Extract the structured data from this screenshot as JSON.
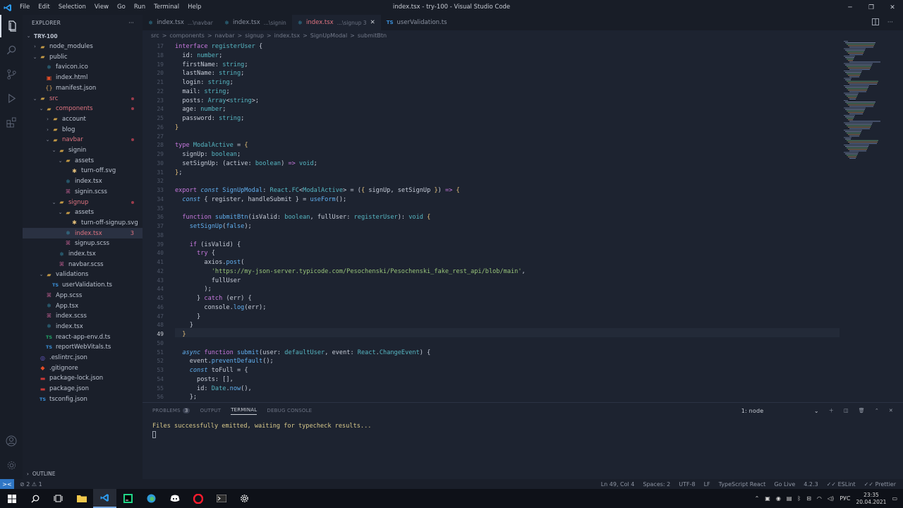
{
  "window": {
    "title": "index.tsx - try-100 - Visual Studio Code",
    "menu": [
      "File",
      "Edit",
      "Selection",
      "View",
      "Go",
      "Run",
      "Terminal",
      "Help"
    ]
  },
  "sidebar": {
    "header": "EXPLORER",
    "more": "···",
    "outline": "OUTLINE",
    "tree": [
      {
        "label": "TRY-100",
        "depth": 0,
        "kind": "root",
        "open": true,
        "color": "norm"
      },
      {
        "label": "node_modules",
        "depth": 1,
        "kind": "folder",
        "open": false,
        "color": "norm"
      },
      {
        "label": "public",
        "depth": 1,
        "kind": "folder",
        "open": true,
        "color": "norm"
      },
      {
        "label": "favicon.ico",
        "depth": 2,
        "kind": "file",
        "icon": "react",
        "color": "norm"
      },
      {
        "label": "index.html",
        "depth": 2,
        "kind": "file",
        "icon": "html",
        "color": "norm"
      },
      {
        "label": "manifest.json",
        "depth": 2,
        "kind": "file",
        "icon": "json",
        "color": "norm"
      },
      {
        "label": "src",
        "depth": 1,
        "kind": "folder",
        "open": true,
        "color": "err",
        "dot": true
      },
      {
        "label": "components",
        "depth": 2,
        "kind": "folder",
        "open": true,
        "color": "err",
        "dot": true
      },
      {
        "label": "account",
        "depth": 3,
        "kind": "folder",
        "open": false,
        "color": "norm"
      },
      {
        "label": "blog",
        "depth": 3,
        "kind": "folder",
        "open": false,
        "color": "norm"
      },
      {
        "label": "navbar",
        "depth": 3,
        "kind": "folder",
        "open": true,
        "color": "err",
        "dot": true
      },
      {
        "label": "signin",
        "depth": 4,
        "kind": "folder",
        "open": true,
        "color": "norm"
      },
      {
        "label": "assets",
        "depth": 5,
        "kind": "folder",
        "open": true,
        "color": "norm"
      },
      {
        "label": "turn-off.svg",
        "depth": 6,
        "kind": "file",
        "icon": "svg",
        "color": "norm"
      },
      {
        "label": "index.tsx",
        "depth": 5,
        "kind": "file",
        "icon": "react",
        "color": "norm"
      },
      {
        "label": "signin.scss",
        "depth": 5,
        "kind": "file",
        "icon": "scss",
        "color": "norm"
      },
      {
        "label": "signup",
        "depth": 4,
        "kind": "folder",
        "open": true,
        "color": "err",
        "dot": true
      },
      {
        "label": "assets",
        "depth": 5,
        "kind": "folder",
        "open": true,
        "color": "norm"
      },
      {
        "label": "turn-off-signup.svg",
        "depth": 6,
        "kind": "file",
        "icon": "svg",
        "color": "norm"
      },
      {
        "label": "index.tsx",
        "depth": 5,
        "kind": "file",
        "icon": "react",
        "color": "err",
        "badge": "3",
        "selected": true
      },
      {
        "label": "signup.scss",
        "depth": 5,
        "kind": "file",
        "icon": "scss",
        "color": "norm"
      },
      {
        "label": "index.tsx",
        "depth": 4,
        "kind": "file",
        "icon": "react",
        "color": "norm"
      },
      {
        "label": "navbar.scss",
        "depth": 4,
        "kind": "file",
        "icon": "scss",
        "color": "norm"
      },
      {
        "label": "validations",
        "depth": 2,
        "kind": "folder",
        "open": true,
        "color": "norm"
      },
      {
        "label": "userValidation.ts",
        "depth": 3,
        "kind": "file",
        "icon": "ts",
        "color": "norm"
      },
      {
        "label": "App.scss",
        "depth": 2,
        "kind": "file",
        "icon": "scss",
        "color": "norm"
      },
      {
        "label": "App.tsx",
        "depth": 2,
        "kind": "file",
        "icon": "react",
        "color": "norm"
      },
      {
        "label": "index.scss",
        "depth": 2,
        "kind": "file",
        "icon": "scss",
        "color": "norm"
      },
      {
        "label": "index.tsx",
        "depth": 2,
        "kind": "file",
        "icon": "react",
        "color": "norm"
      },
      {
        "label": "react-app-env.d.ts",
        "depth": 2,
        "kind": "file",
        "icon": "ts2",
        "color": "norm"
      },
      {
        "label": "reportWebVitals.ts",
        "depth": 2,
        "kind": "file",
        "icon": "ts",
        "color": "norm"
      },
      {
        "label": ".eslintrc.json",
        "depth": 1,
        "kind": "file",
        "icon": "eslint",
        "color": "norm"
      },
      {
        "label": ".gitignore",
        "depth": 1,
        "kind": "file",
        "icon": "git",
        "color": "norm"
      },
      {
        "label": "package-lock.json",
        "depth": 1,
        "kind": "file",
        "icon": "npm",
        "color": "norm"
      },
      {
        "label": "package.json",
        "depth": 1,
        "kind": "file",
        "icon": "npm",
        "color": "norm"
      },
      {
        "label": "tsconfig.json",
        "depth": 1,
        "kind": "file",
        "icon": "ts",
        "color": "norm"
      }
    ]
  },
  "tabs": [
    {
      "name": "index.tsx",
      "sub": "...\\navbar",
      "icon": "react",
      "active": false
    },
    {
      "name": "index.tsx",
      "sub": "...\\signin",
      "icon": "react",
      "active": false
    },
    {
      "name": "index.tsx",
      "sub": "...\\signup 3",
      "icon": "react",
      "active": true,
      "close": "✕"
    },
    {
      "name": "userValidation.ts",
      "sub": "",
      "icon": "ts",
      "active": false
    }
  ],
  "breadcrumb": [
    "src",
    ">",
    "components",
    ">",
    "navbar",
    ">",
    "signup",
    ">",
    "index.tsx",
    ">",
    "SignUpModal",
    ">",
    "submitBtn"
  ],
  "code": {
    "lines": [
      {
        "n": "17",
        "t": [
          [
            "kw",
            "interface "
          ],
          [
            "ty",
            "registerUser"
          ],
          [
            "pu",
            " {"
          ]
        ]
      },
      {
        "n": "18",
        "t": [
          [
            "pu",
            "  id"
          ],
          [
            "pu",
            ": "
          ],
          [
            "ty",
            "number"
          ],
          [
            "pu",
            ";"
          ]
        ]
      },
      {
        "n": "19",
        "t": [
          [
            "pu",
            "  firstName"
          ],
          [
            "pu",
            ": "
          ],
          [
            "ty",
            "string"
          ],
          [
            "pu",
            ";"
          ]
        ]
      },
      {
        "n": "20",
        "t": [
          [
            "pu",
            "  lastName"
          ],
          [
            "pu",
            ": "
          ],
          [
            "ty",
            "string"
          ],
          [
            "pu",
            ";"
          ]
        ]
      },
      {
        "n": "21",
        "t": [
          [
            "pu",
            "  login"
          ],
          [
            "pu",
            ": "
          ],
          [
            "ty",
            "string"
          ],
          [
            "pu",
            ";"
          ]
        ]
      },
      {
        "n": "22",
        "t": [
          [
            "pu",
            "  mail"
          ],
          [
            "pu",
            ": "
          ],
          [
            "ty",
            "string"
          ],
          [
            "pu",
            ";"
          ]
        ]
      },
      {
        "n": "23",
        "t": [
          [
            "pu",
            "  posts"
          ],
          [
            "pu",
            ": "
          ],
          [
            "ty",
            "Array"
          ],
          [
            "pu",
            "<"
          ],
          [
            "ty",
            "string"
          ],
          [
            "pu",
            ">;"
          ]
        ]
      },
      {
        "n": "24",
        "t": [
          [
            "pu",
            "  age"
          ],
          [
            "pu",
            ": "
          ],
          [
            "ty",
            "number"
          ],
          [
            "pu",
            ";"
          ]
        ]
      },
      {
        "n": "25",
        "t": [
          [
            "pu",
            "  password"
          ],
          [
            "pu",
            ": "
          ],
          [
            "ty",
            "string"
          ],
          [
            "pu",
            ";"
          ]
        ]
      },
      {
        "n": "26",
        "t": [
          [
            "pa",
            "}"
          ]
        ]
      },
      {
        "n": "27",
        "t": []
      },
      {
        "n": "28",
        "t": [
          [
            "kw",
            "type "
          ],
          [
            "ty",
            "ModalActive"
          ],
          [
            "pu",
            " = "
          ],
          [
            "pa",
            "{"
          ]
        ]
      },
      {
        "n": "29",
        "t": [
          [
            "pu",
            "  signUp"
          ],
          [
            "pu",
            ": "
          ],
          [
            "ty",
            "boolean"
          ],
          [
            "pu",
            ";"
          ]
        ]
      },
      {
        "n": "30",
        "t": [
          [
            "pu",
            "  setSignUp"
          ],
          [
            "pu",
            ": ("
          ],
          [
            "pu",
            "active"
          ],
          [
            "pu",
            ": "
          ],
          [
            "ty",
            "boolean"
          ],
          [
            "pu",
            ") "
          ],
          [
            "kw",
            "=> "
          ],
          [
            "ty",
            "void"
          ],
          [
            "pu",
            ";"
          ]
        ]
      },
      {
        "n": "31",
        "t": [
          [
            "pa",
            "}"
          ],
          [
            "pu",
            ";"
          ]
        ]
      },
      {
        "n": "32",
        "t": []
      },
      {
        "n": "33",
        "t": [
          [
            "kw",
            "export "
          ],
          [
            "kb it",
            "const "
          ],
          [
            "fn",
            "SignUpModal"
          ],
          [
            "pu",
            ": "
          ],
          [
            "ty",
            "React"
          ],
          [
            "pu",
            "."
          ],
          [
            "ty",
            "FC"
          ],
          [
            "pu",
            "<"
          ],
          [
            "ty",
            "ModalActive"
          ],
          [
            "pu",
            "> = ("
          ],
          [
            "pa",
            "{ "
          ],
          [
            "pu",
            "signUp"
          ],
          [
            "pu",
            ", "
          ],
          [
            "pu",
            "setSignUp "
          ],
          [
            "pa",
            "}"
          ],
          [
            "pu",
            ") "
          ],
          [
            "kw",
            "=> "
          ],
          [
            "pa",
            "{"
          ]
        ]
      },
      {
        "n": "34",
        "t": [
          [
            "kb it",
            "  const "
          ],
          [
            "pu",
            "{ register, handleSubmit } = "
          ],
          [
            "fn",
            "useForm"
          ],
          [
            "pu",
            "();"
          ]
        ]
      },
      {
        "n": "35",
        "t": []
      },
      {
        "n": "36",
        "t": [
          [
            "kw",
            "  function "
          ],
          [
            "fn",
            "submitBtn"
          ],
          [
            "pu",
            "("
          ],
          [
            "pu",
            "isValid"
          ],
          [
            "pu",
            ": "
          ],
          [
            "ty",
            "boolean"
          ],
          [
            "pu",
            ", "
          ],
          [
            "pu",
            "fullUser"
          ],
          [
            "pu",
            ": "
          ],
          [
            "ty",
            "registerUser"
          ],
          [
            "pu",
            "): "
          ],
          [
            "ty",
            "void "
          ],
          [
            "pa",
            "{"
          ]
        ]
      },
      {
        "n": "37",
        "t": [
          [
            "fn",
            "    setSignUp"
          ],
          [
            "pu",
            "("
          ],
          [
            "kb",
            "false"
          ],
          [
            "pu",
            ");"
          ]
        ]
      },
      {
        "n": "38",
        "t": []
      },
      {
        "n": "39",
        "t": [
          [
            "kw",
            "    if "
          ],
          [
            "pu",
            "(isValid) {"
          ]
        ]
      },
      {
        "n": "40",
        "t": [
          [
            "kw",
            "      try "
          ],
          [
            "pu",
            "{"
          ]
        ]
      },
      {
        "n": "41",
        "t": [
          [
            "pu",
            "        axios."
          ],
          [
            "fn",
            "post"
          ],
          [
            "pu",
            "("
          ]
        ]
      },
      {
        "n": "42",
        "t": [
          [
            "st",
            "          'https://my-json-server.typicode.com/Pesochenski/Pesochenski_fake_rest_api/blob/main'"
          ],
          [
            "pu",
            ","
          ]
        ]
      },
      {
        "n": "43",
        "t": [
          [
            "pu",
            "          fullUser"
          ]
        ]
      },
      {
        "n": "44",
        "t": [
          [
            "pu",
            "        );"
          ]
        ]
      },
      {
        "n": "45",
        "t": [
          [
            "pu",
            "      } "
          ],
          [
            "kw",
            "catch "
          ],
          [
            "pu",
            "(err) {"
          ]
        ]
      },
      {
        "n": "46",
        "t": [
          [
            "pu",
            "        console."
          ],
          [
            "fn",
            "log"
          ],
          [
            "pu",
            "(err);"
          ]
        ]
      },
      {
        "n": "47",
        "t": [
          [
            "pu",
            "      }"
          ]
        ]
      },
      {
        "n": "48",
        "t": [
          [
            "pu",
            "    }"
          ]
        ]
      },
      {
        "n": "49",
        "t": [
          [
            "pa",
            "  }"
          ]
        ],
        "current": true
      },
      {
        "n": "50",
        "t": []
      },
      {
        "n": "51",
        "t": [
          [
            "kb it",
            "  async "
          ],
          [
            "kw",
            "function "
          ],
          [
            "fn",
            "submit"
          ],
          [
            "pu",
            "("
          ],
          [
            "pu",
            "user"
          ],
          [
            "pu",
            ": "
          ],
          [
            "ty",
            "defaultUser"
          ],
          [
            "pu",
            ", "
          ],
          [
            "pu",
            "event"
          ],
          [
            "pu",
            ": "
          ],
          [
            "ty",
            "React"
          ],
          [
            "pu",
            "."
          ],
          [
            "ty",
            "ChangeEvent"
          ],
          [
            "pu",
            ") {"
          ]
        ]
      },
      {
        "n": "52",
        "t": [
          [
            "pu",
            "    event."
          ],
          [
            "fn",
            "preventDefault"
          ],
          [
            "pu",
            "();"
          ]
        ]
      },
      {
        "n": "53",
        "t": [
          [
            "kb it",
            "    const "
          ],
          [
            "pu",
            "toFull = {"
          ]
        ]
      },
      {
        "n": "54",
        "t": [
          [
            "pu",
            "      posts: [],"
          ]
        ]
      },
      {
        "n": "55",
        "t": [
          [
            "pu",
            "      id: "
          ],
          [
            "ty",
            "Date"
          ],
          [
            "pu",
            "."
          ],
          [
            "fn",
            "now"
          ],
          [
            "pu",
            "(),"
          ]
        ]
      },
      {
        "n": "56",
        "t": [
          [
            "pu",
            "    };"
          ]
        ]
      }
    ]
  },
  "panel": {
    "tabs": [
      "PROBLEMS",
      "OUTPUT",
      "TERMINAL",
      "DEBUG CONSOLE"
    ],
    "problems_count": "3",
    "active_tab": "TERMINAL",
    "terminal_select": "1: node",
    "output": "Files successfully emitted, waiting for typecheck results..."
  },
  "statusbar": {
    "remote": "><",
    "problems": "⊘ 2 ⚠ 1",
    "items": [
      "Ln 49, Col 4",
      "Spaces: 2",
      "UTF-8",
      "LF",
      "TypeScript React",
      "Go Live",
      "4.2.3",
      "✓✓ ESLint",
      "✓✓ Prettier"
    ]
  },
  "taskbar": {
    "lang": "РУС",
    "time": "23:35",
    "date": "20.04.2021"
  },
  "colors": {
    "accent": "#2f76c4",
    "error": "#e07480",
    "editor_bg": "#1d2330",
    "sidebar_bg": "#1a1f2a"
  }
}
